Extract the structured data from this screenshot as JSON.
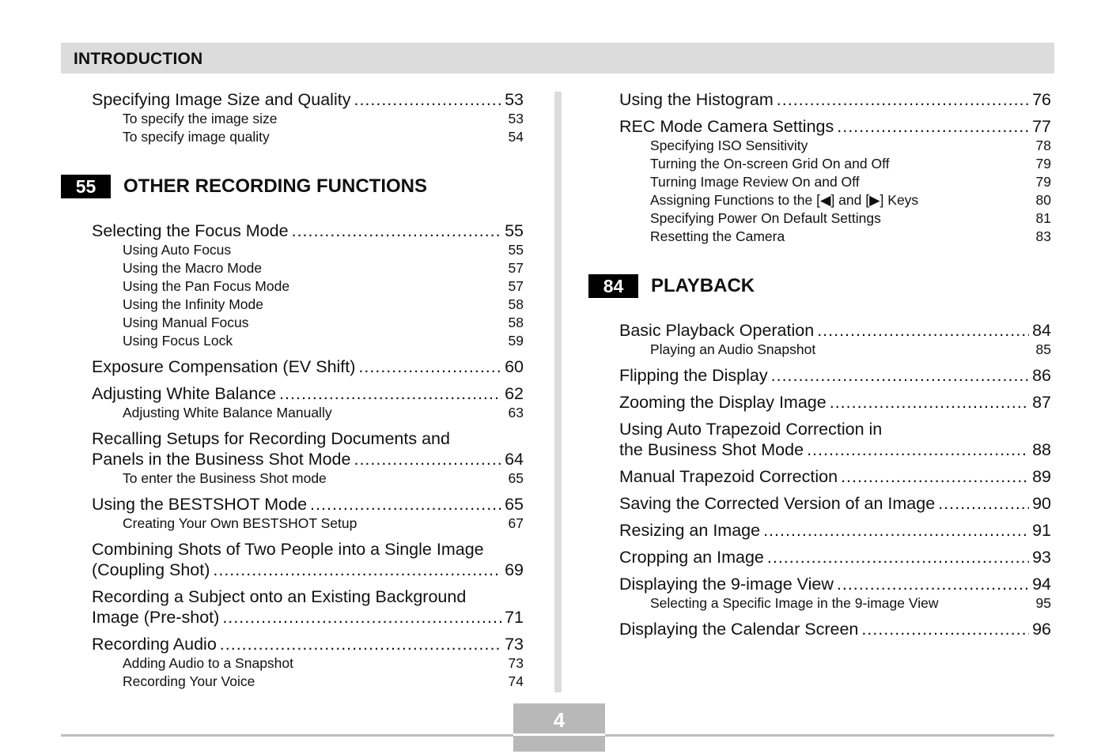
{
  "header": {
    "title": "INTRODUCTION"
  },
  "left_column": {
    "entries_top": [
      {
        "title": "Specifying Image Size and Quality",
        "page": "53",
        "subs": [
          {
            "title": "To specify the image size",
            "page": "53"
          },
          {
            "title": "To specify image quality",
            "page": "54"
          }
        ]
      }
    ],
    "section": {
      "number": "55",
      "title": "OTHER RECORDING FUNCTIONS"
    },
    "entries": [
      {
        "title": "Selecting the Focus Mode",
        "page": "55",
        "subs": [
          {
            "title": "Using Auto Focus",
            "page": "55"
          },
          {
            "title": "Using the Macro Mode",
            "page": "57"
          },
          {
            "title": "Using the Pan Focus Mode",
            "page": "57"
          },
          {
            "title": "Using the Infinity Mode",
            "page": "58"
          },
          {
            "title": "Using Manual Focus",
            "page": "58"
          },
          {
            "title": "Using Focus Lock",
            "page": "59"
          }
        ]
      },
      {
        "title": "Exposure Compensation (EV Shift)",
        "page": "60",
        "subs": []
      },
      {
        "title": "Adjusting White Balance",
        "page": "62",
        "subs": [
          {
            "title": "Adjusting White Balance Manually",
            "page": "63"
          }
        ]
      },
      {
        "pre": "Recalling Setups for Recording Documents and",
        "title": "Panels in the Business Shot Mode",
        "page": "64",
        "subs": [
          {
            "title": "To enter the Business Shot mode",
            "page": "65"
          }
        ]
      },
      {
        "title": "Using the BESTSHOT Mode",
        "page": "65",
        "subs": [
          {
            "title": "Creating Your Own BESTSHOT Setup",
            "page": "67"
          }
        ]
      },
      {
        "pre": "Combining Shots of Two People into a Single Image",
        "title": "(Coupling Shot)",
        "page": "69",
        "subs": []
      },
      {
        "pre": "Recording a Subject onto an Existing Background",
        "title": "Image (Pre-shot)",
        "page": "71",
        "subs": []
      },
      {
        "title": "Recording Audio",
        "page": "73",
        "subs": [
          {
            "title": "Adding Audio to a Snapshot",
            "page": "73"
          },
          {
            "title": "Recording Your Voice",
            "page": "74"
          }
        ]
      }
    ]
  },
  "right_column": {
    "entries_top": [
      {
        "title": "Using the Histogram",
        "page": "76",
        "subs": []
      },
      {
        "title": "REC Mode Camera Settings",
        "page": "77",
        "subs": [
          {
            "title": "Specifying ISO Sensitivity",
            "page": "78"
          },
          {
            "title": "Turning the On-screen Grid On and Off",
            "page": "79"
          },
          {
            "title": "Turning Image Review On and Off",
            "page": "79"
          },
          {
            "title": "Assigning Functions to the [◀] and [▶] Keys",
            "page": "80"
          },
          {
            "title": "Specifying Power On Default Settings",
            "page": "81"
          },
          {
            "title": "Resetting the Camera",
            "page": "83"
          }
        ]
      }
    ],
    "section": {
      "number": "84",
      "title": "PLAYBACK"
    },
    "entries": [
      {
        "title": "Basic Playback Operation",
        "page": "84",
        "subs": [
          {
            "title": "Playing an Audio Snapshot",
            "page": "85"
          }
        ]
      },
      {
        "title": "Flipping the Display",
        "page": "86",
        "subs": []
      },
      {
        "title": "Zooming the Display Image",
        "page": "87",
        "subs": []
      },
      {
        "pre": "Using Auto Trapezoid Correction in",
        "title": "the Business Shot Mode",
        "page": "88",
        "subs": []
      },
      {
        "title": "Manual Trapezoid Correction",
        "page": "89",
        "subs": []
      },
      {
        "title": "Saving the Corrected Version of an Image",
        "page": "90",
        "subs": []
      },
      {
        "title": "Resizing an Image",
        "page": "91",
        "subs": []
      },
      {
        "title": "Cropping an Image",
        "page": "93",
        "subs": []
      },
      {
        "title": "Displaying the 9-image View",
        "page": "94",
        "subs": [
          {
            "title": "Selecting a Specific Image in the 9-image View",
            "page": "95"
          }
        ]
      },
      {
        "title": "Displaying the Calendar Screen",
        "page": "96",
        "subs": []
      }
    ]
  },
  "footer": {
    "page_number": "4"
  }
}
